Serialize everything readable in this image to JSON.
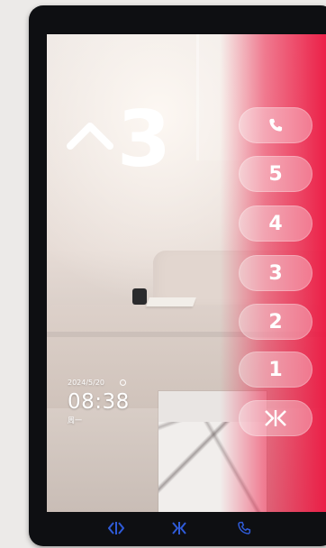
{
  "floor_display": {
    "direction_icon": "up-arrow-icon",
    "floor": "3"
  },
  "clock": {
    "date": "2024/5/20",
    "time": "08:38",
    "weekday": "周一"
  },
  "buttons": [
    {
      "name": "call-button",
      "icon": "phone-icon",
      "label": ""
    },
    {
      "name": "floor-5-button",
      "label": "5"
    },
    {
      "name": "floor-4-button",
      "label": "4"
    },
    {
      "name": "floor-3-button",
      "label": "3"
    },
    {
      "name": "floor-2-button",
      "label": "2"
    },
    {
      "name": "floor-1-button",
      "label": "1"
    },
    {
      "name": "door-close-button",
      "icon": "door-close-icon",
      "label": ""
    }
  ],
  "bottom_nav": {
    "icons": [
      "door-open-icon",
      "door-close-icon",
      "phone-icon"
    ],
    "color": "#2f5bd8"
  },
  "colors": {
    "accent": "#ee1c46",
    "text": "#ffffff"
  }
}
